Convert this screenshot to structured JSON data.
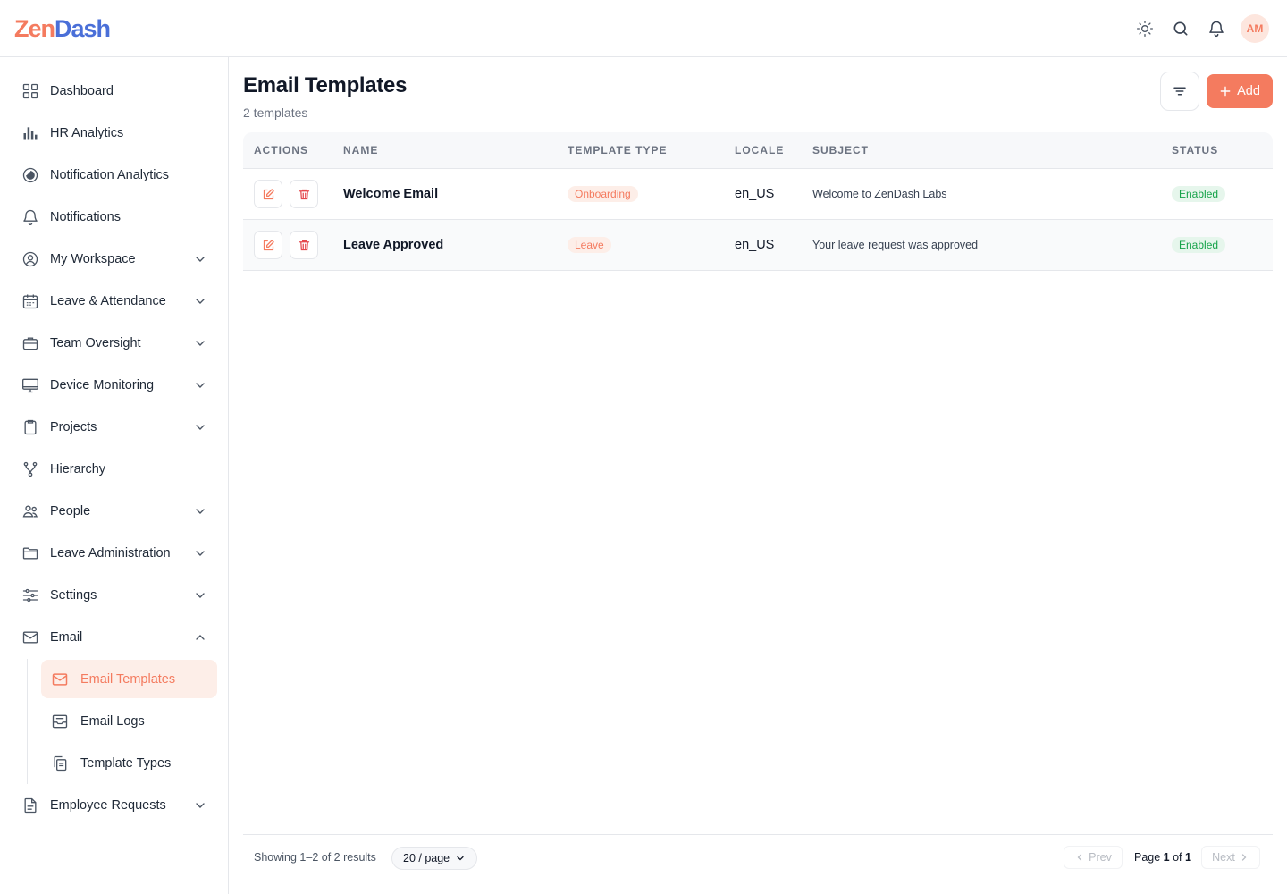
{
  "brand": {
    "part1": "Zen",
    "part2": "Dash",
    "color1": "#f47b5f",
    "color2": "#4a6fd8"
  },
  "header": {
    "icons": [
      "sun-icon",
      "search-icon",
      "bell-icon"
    ],
    "avatar_initials": "AM"
  },
  "sidebar": {
    "items": [
      {
        "label": "Dashboard",
        "icon": "grid-icon",
        "expandable": false
      },
      {
        "label": "HR Analytics",
        "icon": "bar-chart-icon",
        "expandable": false
      },
      {
        "label": "Notification Analytics",
        "icon": "pie-chart-icon",
        "expandable": false
      },
      {
        "label": "Notifications",
        "icon": "bell-icon",
        "expandable": false
      },
      {
        "label": "My Workspace",
        "icon": "user-circle-icon",
        "expandable": true
      },
      {
        "label": "Leave & Attendance",
        "icon": "calendar-icon",
        "expandable": true
      },
      {
        "label": "Team Oversight",
        "icon": "briefcase-icon",
        "expandable": true
      },
      {
        "label": "Device Monitoring",
        "icon": "monitor-icon",
        "expandable": true
      },
      {
        "label": "Projects",
        "icon": "clipboard-icon",
        "expandable": true
      },
      {
        "label": "Hierarchy",
        "icon": "hierarchy-icon",
        "expandable": false
      },
      {
        "label": "People",
        "icon": "people-icon",
        "expandable": true
      },
      {
        "label": "Leave Administration",
        "icon": "folder-icon",
        "expandable": true
      },
      {
        "label": "Settings",
        "icon": "sliders-icon",
        "expandable": true
      },
      {
        "label": "Email",
        "icon": "mail-icon",
        "expandable": true,
        "expanded": true
      },
      {
        "label": "Employee Requests",
        "icon": "document-icon",
        "expandable": true
      }
    ],
    "email_sub": [
      {
        "label": "Email Templates",
        "icon": "mail-icon",
        "active": true
      },
      {
        "label": "Email Logs",
        "icon": "inbox-icon",
        "active": false
      },
      {
        "label": "Template Types",
        "icon": "copy-icon",
        "active": false
      }
    ]
  },
  "page": {
    "title": "Email Templates",
    "subtitle": "2 templates",
    "add_label": "Add"
  },
  "table": {
    "columns": [
      "ACTIONS",
      "NAME",
      "TEMPLATE TYPE",
      "LOCALE",
      "SUBJECT",
      "STATUS"
    ],
    "rows": [
      {
        "name": "Welcome Email",
        "type": "Onboarding",
        "locale": "en_US",
        "subject": "Welcome to ZenDash Labs",
        "status": "Enabled"
      },
      {
        "name": "Leave Approved",
        "type": "Leave",
        "locale": "en_US",
        "subject": "Your leave request was approved",
        "status": "Enabled"
      }
    ]
  },
  "footer": {
    "showing": "Showing 1–2 of 2 results",
    "per_page": "20 / page",
    "prev": "Prev",
    "page_prefix": "Page ",
    "page_current": "1",
    "page_mid": " of ",
    "page_total": "1",
    "next": "Next"
  },
  "colors": {
    "accent": "#f47b5f",
    "enabled": "#16a34a"
  }
}
